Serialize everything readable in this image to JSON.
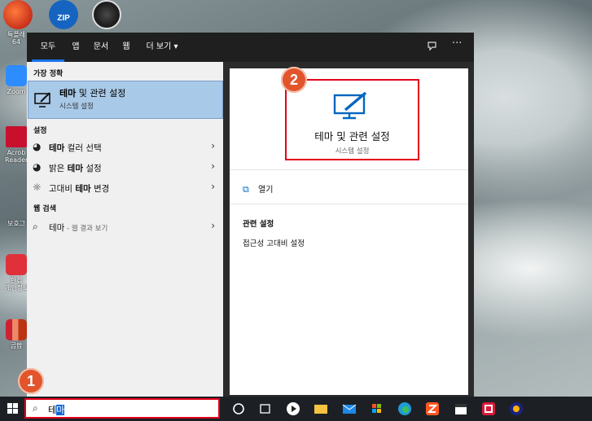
{
  "desktop": {
    "icons": [
      {
        "label": "툭플레\n64"
      },
      {
        "label": "Zoom"
      },
      {
        "label": "Acrob\nReader"
      },
      {
        "label": "보호그"
      },
      {
        "label": "한컴\n개인정보"
      },
      {
        "label": "곰팝"
      }
    ],
    "top_icons": [
      "ZIP"
    ]
  },
  "start_menu": {
    "tabs": [
      "모두",
      "앱",
      "문서",
      "웹",
      "더 보기 ▾"
    ],
    "top_right": [
      "feedback-icon",
      "more-icon"
    ],
    "best_match": {
      "section": "가장 정확",
      "title_bold": "테마",
      "title_rest": " 및 관련 설정",
      "subtitle": "시스템 설정"
    },
    "settings": {
      "section": "설정",
      "items": [
        {
          "pre": "",
          "bold": "테마",
          "post": " 컬러 선택",
          "icon": "palette-icon"
        },
        {
          "pre": "밝은 ",
          "bold": "테마",
          "post": " 설정",
          "icon": "palette-icon"
        },
        {
          "pre": "고대비 ",
          "bold": "테마",
          "post": " 변경",
          "icon": "sun-icon"
        }
      ]
    },
    "web": {
      "section": "웹 검색",
      "query": "테마",
      "suffix": " - 웹 결과 보기"
    },
    "detail": {
      "title": "테마 및 관련 설정",
      "subtitle": "시스템 설정",
      "open_label": "열기",
      "related_heading": "관련 설정",
      "related_items": [
        "접근성 고대비 설정"
      ]
    }
  },
  "annotations": {
    "step1": "1",
    "step2": "2"
  },
  "taskbar": {
    "search_query_plain": "테",
    "search_query_selected": "마"
  },
  "colors": {
    "accent": "#1a73e8",
    "highlight_box": "#e3001b",
    "badge": "#e2552c",
    "best_match_bg": "#a9c9e8"
  }
}
